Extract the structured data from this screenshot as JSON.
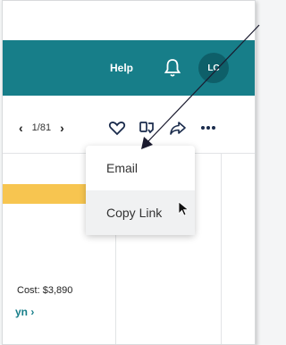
{
  "header": {
    "help_label": "Help",
    "avatar_initials": "LC"
  },
  "pager": {
    "prev": "‹",
    "count": "1/81",
    "next": "›"
  },
  "menu": {
    "items": [
      "Email",
      "Copy Link"
    ]
  },
  "content": {
    "cost_text": "Cost: $3,890",
    "link_fragment": "yn ›"
  },
  "colors": {
    "header": "#177e89",
    "avatar": "#0e5f69",
    "accent_bar": "#f7c550"
  },
  "icons": [
    "bell-icon",
    "heart-icon",
    "compare-icon",
    "share-icon",
    "more-icon",
    "cursor-icon",
    "annotation-arrow"
  ]
}
